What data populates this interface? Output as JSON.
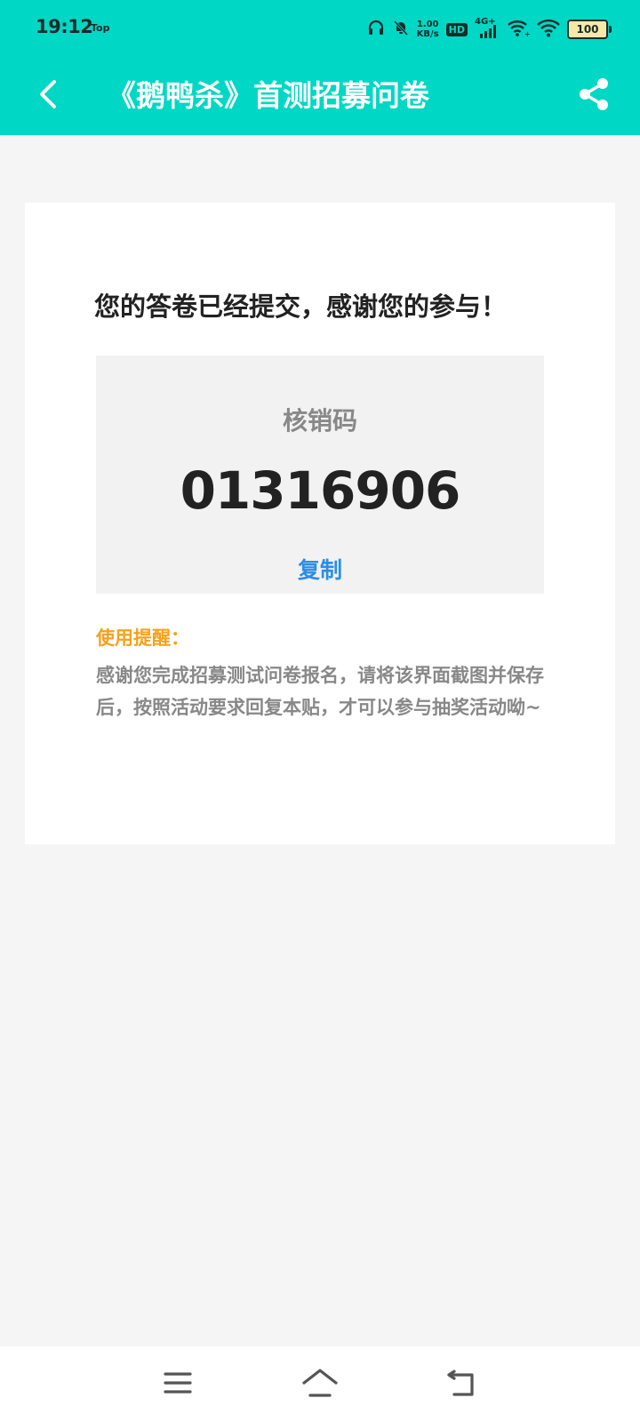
{
  "status_bar": {
    "time": "19:12",
    "top_label": "Top",
    "speed_value": "1.00",
    "speed_unit": "KB/s",
    "hd_label": "HD",
    "network_label": "4G+",
    "battery_level": "100",
    "icons": [
      "headphones-icon",
      "mute-bell-icon",
      "hd-icon",
      "signal-icon",
      "wifi-calling-icon",
      "wifi-icon",
      "battery-icon"
    ]
  },
  "header": {
    "title": "《鹅鸭杀》首测招募问卷",
    "back_icon": "chevron-left-icon",
    "share_icon": "share-icon",
    "background": "#00d7c4"
  },
  "result": {
    "message": "您的答卷已经提交，感谢您的参与！",
    "code_label": "核销码",
    "code_value": "01316906",
    "copy_label": "复制",
    "reminder_title": "使用提醒：",
    "reminder_text": "感谢您完成招募测试问卷报名，请将该界面截图并保存后，按照活动要求回复本贴，才可以参与抽奖活动呦~"
  },
  "nav_bar": {
    "icons": [
      "menu-icon",
      "home-icon",
      "back-icon"
    ]
  },
  "colors": {
    "accent": "#00d7c4",
    "link": "#2a8ee8",
    "warning": "#f5a11c"
  }
}
